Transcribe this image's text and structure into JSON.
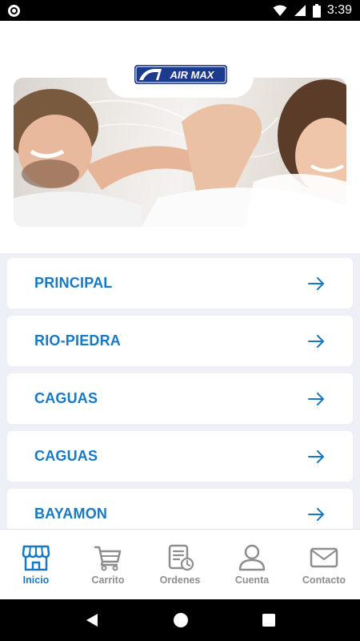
{
  "status_bar": {
    "time": "3:39",
    "left_icon": "screen-record-icon",
    "right_icons": [
      "wifi-icon",
      "signal-icon",
      "battery-icon"
    ]
  },
  "header": {
    "logo_text": "AIR MAX",
    "banner": "couple-relaxing-photo",
    "pager": {
      "count": 1,
      "active": 0
    }
  },
  "branches": [
    {
      "label": "PRINCIPAL"
    },
    {
      "label": "RIO-PIEDRA"
    },
    {
      "label": "CAGUAS"
    },
    {
      "label": "CAGUAS"
    },
    {
      "label": "BAYAMON"
    }
  ],
  "bottom_nav": [
    {
      "label": "Inicio",
      "icon": "store-icon",
      "active": true
    },
    {
      "label": "Carrito",
      "icon": "cart-icon",
      "active": false
    },
    {
      "label": "Ordenes",
      "icon": "orders-icon",
      "active": false
    },
    {
      "label": "Cuenta",
      "icon": "account-icon",
      "active": false
    },
    {
      "label": "Contacto",
      "icon": "mail-icon",
      "active": false
    }
  ],
  "colors": {
    "accent": "#1779c4",
    "inactive": "#8e8e8e",
    "list_background": "#eef0f8"
  }
}
